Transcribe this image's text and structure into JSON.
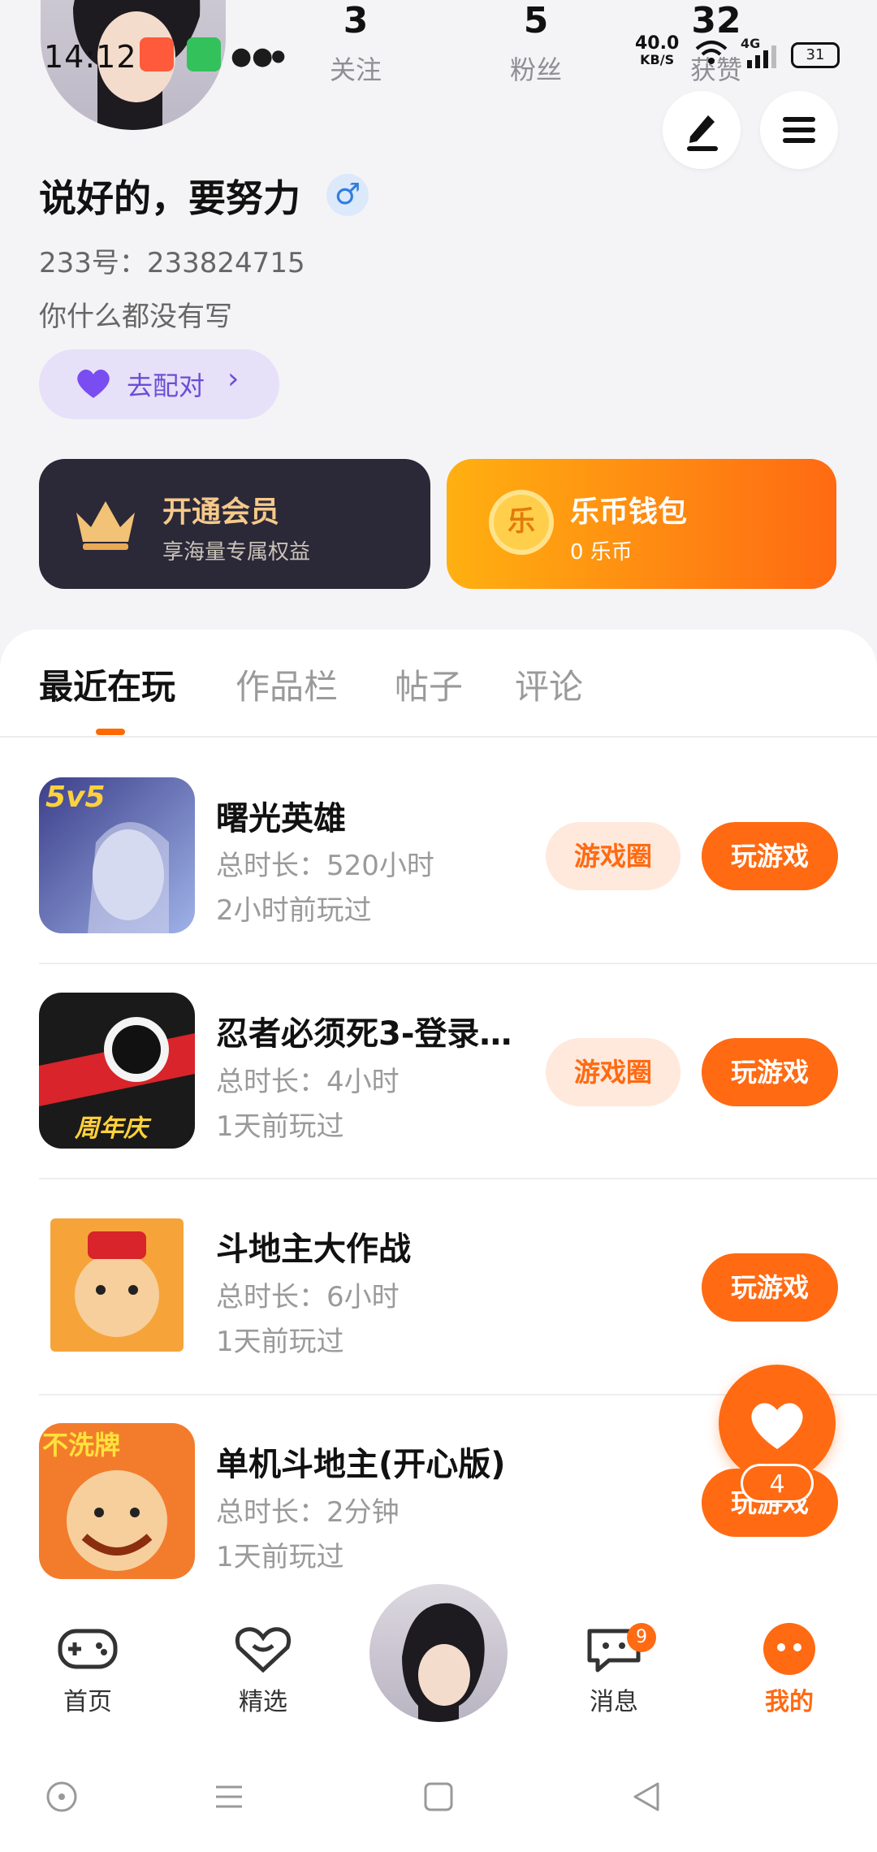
{
  "status_bar": {
    "time": "14:12",
    "net_speed": "40.0",
    "net_unit": "KB/S",
    "signal": "4G",
    "battery": "31"
  },
  "profile": {
    "stats": [
      {
        "value": "3",
        "label": "关注"
      },
      {
        "value": "5",
        "label": "粉丝"
      },
      {
        "value": "32",
        "label": "获赞"
      }
    ],
    "name": "说好的，要努力",
    "gender_symbol": "♂",
    "uid": "233号：233824715",
    "bio": "你什么都没有写",
    "pair_label": "去配对"
  },
  "cards": {
    "vip_title": "开通会员",
    "vip_sub": "享海量专属权益",
    "wallet_title": "乐币钱包",
    "wallet_sub": "0 乐币",
    "coin_glyph": "乐"
  },
  "tabs": [
    "最近在玩",
    "作品栏",
    "帖子",
    "评论"
  ],
  "games": [
    {
      "title": "曙光英雄",
      "duration": "总时长：520小时",
      "last": "2小时前玩过",
      "circle": "游戏圈",
      "play": "玩游戏",
      "tag": "5v5"
    },
    {
      "title": "忍者必须死3-登录…",
      "duration": "总时长：4小时",
      "last": "1天前玩过",
      "circle": "游戏圈",
      "play": "玩游戏",
      "tag": "周年庆"
    },
    {
      "title": "斗地主大作战",
      "duration": "总时长：6小时",
      "last": "1天前玩过",
      "play": "玩游戏"
    },
    {
      "title": "单机斗地主(开心版)",
      "duration": "总时长：2分钟",
      "last": "1天前玩过",
      "play": "玩游戏",
      "tag": "不洗牌"
    }
  ],
  "fab_count": "4",
  "nav": [
    {
      "label": "首页"
    },
    {
      "label": "精选"
    },
    {
      "label": "消息",
      "badge": "9"
    },
    {
      "label": "我的"
    }
  ],
  "colors": {
    "accent": "#ff6a12",
    "vip_bg": "#2b2838",
    "pair_bg": "#e6e1f8"
  }
}
